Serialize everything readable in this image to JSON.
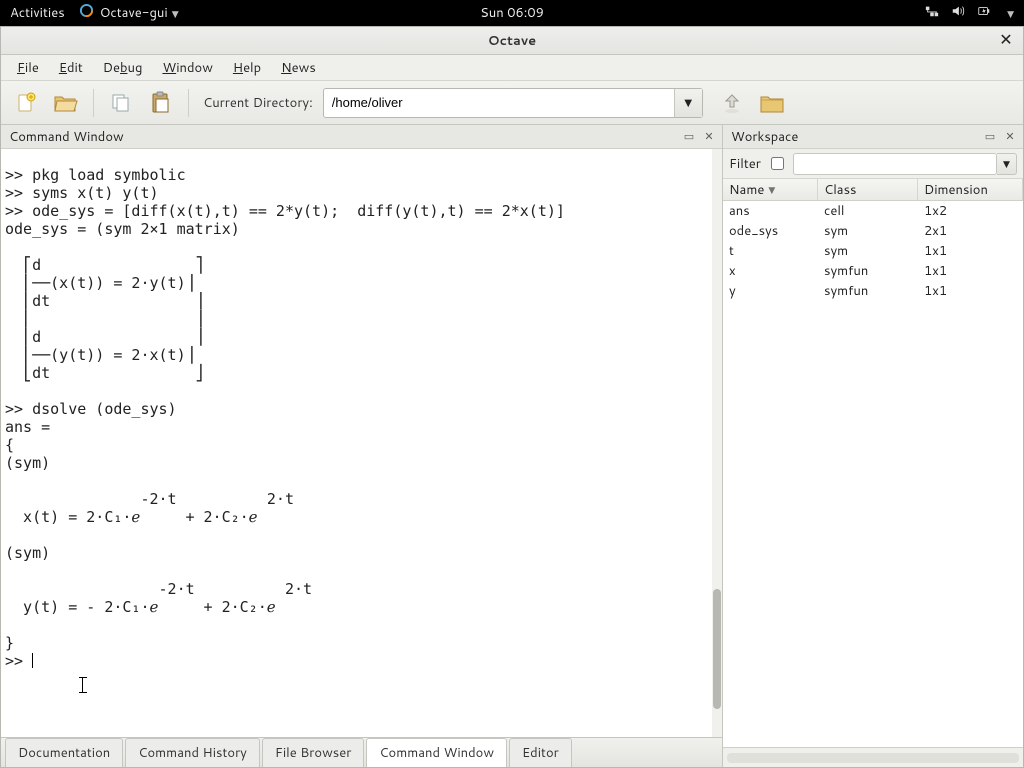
{
  "gnome": {
    "activities": "Activities",
    "app_name": "Octave-gui",
    "clock": "Sun 06:09"
  },
  "window": {
    "title": "Octave"
  },
  "menubar": [
    {
      "label": "File",
      "accel": "F"
    },
    {
      "label": "Edit",
      "accel": "E"
    },
    {
      "label": "Debug",
      "accel": "D"
    },
    {
      "label": "Window",
      "accel": "W"
    },
    {
      "label": "Help",
      "accel": "H"
    },
    {
      "label": "News",
      "accel": "N"
    }
  ],
  "toolbar": {
    "current_directory_label": "Current Directory:",
    "current_directory_value": "/home/oliver"
  },
  "left_pane": {
    "title": "Command Window",
    "console": ">> pkg load symbolic\n>> syms x(t) y(t)\n>> ode_sys = [diff(x(t),t) == 2*y(t);  diff(y(t),t) == 2*x(t)]\node_sys = (sym 2×1 matrix)\n\n  ⎡d                 ⎤\n  ⎢──(x(t)) = 2⋅y(t)⎥\n  ⎢dt                ⎥\n  ⎢                  ⎥\n  ⎢d                 ⎥\n  ⎢──(y(t)) = 2⋅x(t)⎥\n  ⎣dt                ⎦\n\n>> dsolve (ode_sys)\nans =\n{\n(sym)\n\n               -2⋅t          2⋅t\n  x(t) = 2⋅C₁⋅ℯ     + 2⋅C₂⋅ℯ\n\n(sym)\n\n                 -2⋅t          2⋅t\n  y(t) = - 2⋅C₁⋅ℯ     + 2⋅C₂⋅ℯ\n\n}\n>> ",
    "tabs": [
      "Documentation",
      "Command History",
      "File Browser",
      "Command Window",
      "Editor"
    ],
    "active_tab": 3
  },
  "right_pane": {
    "title": "Workspace",
    "filter_label": "Filter",
    "filter_checked": false,
    "filter_value": "",
    "columns": [
      "Name",
      "Class",
      "Dimension"
    ],
    "sort_col": 0,
    "rows": [
      {
        "name": "ans",
        "class": "cell",
        "dim": "1x2"
      },
      {
        "name": "ode_sys",
        "class": "sym",
        "dim": "2x1"
      },
      {
        "name": "t",
        "class": "sym",
        "dim": "1x1"
      },
      {
        "name": "x",
        "class": "symfun",
        "dim": "1x1"
      },
      {
        "name": "y",
        "class": "symfun",
        "dim": "1x1"
      }
    ]
  }
}
